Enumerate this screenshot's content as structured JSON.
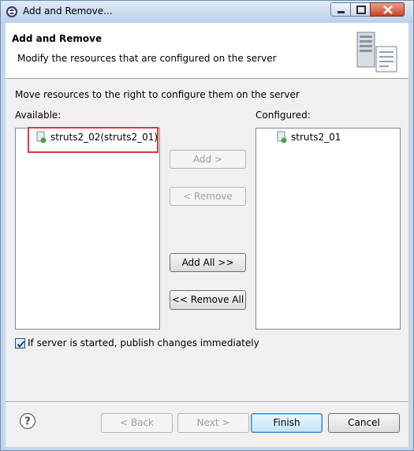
{
  "window": {
    "title": "Add and Remove..."
  },
  "header": {
    "title": "Add and Remove",
    "subtitle": "Modify the resources that are configured on the server"
  },
  "instructions": "Move resources to the right to configure them on the server",
  "available": {
    "label": "Available:",
    "items": [
      "struts2_02(struts2_01)"
    ]
  },
  "configured": {
    "label": "Configured:",
    "items": [
      "struts2_01"
    ]
  },
  "buttons": {
    "add": "Add >",
    "remove": "< Remove",
    "add_all": "Add All >>",
    "remove_all": "<< Remove All",
    "back": "< Back",
    "next": "Next >",
    "finish": "Finish",
    "cancel": "Cancel"
  },
  "publish_option": {
    "label": "If server is started, publish changes immediately",
    "checked": true
  },
  "colors": {
    "highlight": "#d93b3b",
    "title_bar": "#c4d6ec"
  }
}
